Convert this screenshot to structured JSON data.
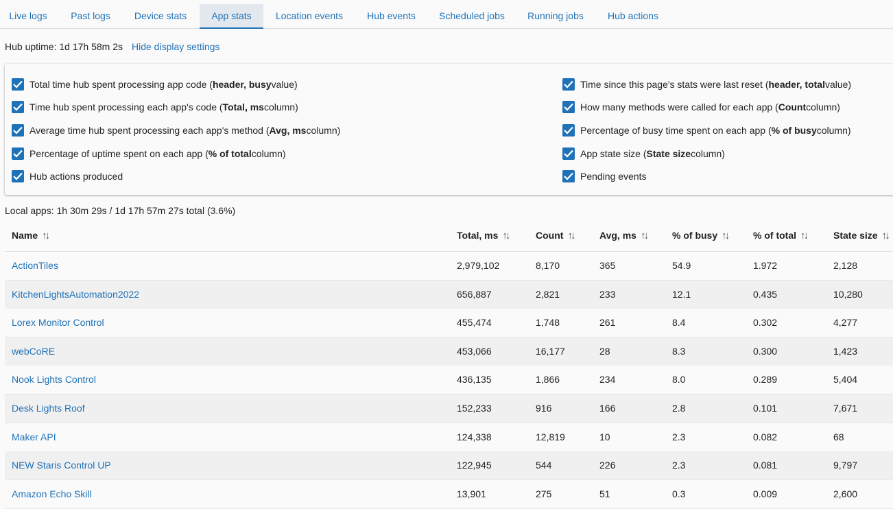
{
  "tabs": [
    {
      "label": "Live logs",
      "active": false
    },
    {
      "label": "Past logs",
      "active": false
    },
    {
      "label": "Device stats",
      "active": false
    },
    {
      "label": "App stats",
      "active": true
    },
    {
      "label": "Location events",
      "active": false
    },
    {
      "label": "Hub events",
      "active": false
    },
    {
      "label": "Scheduled jobs",
      "active": false
    },
    {
      "label": "Running jobs",
      "active": false
    },
    {
      "label": "Hub actions",
      "active": false
    }
  ],
  "uptime": {
    "text": "Hub uptime: 1d 17h 58m 2s",
    "toggle_label": "Hide display settings"
  },
  "settings": {
    "left": [
      {
        "pre": "Total time hub spent processing app code (",
        "bold": "header, busy",
        "post": " value)",
        "checked": true
      },
      {
        "pre": "Time hub spent processing each app's code (",
        "bold": "Total, ms",
        "post": " column)",
        "checked": true
      },
      {
        "pre": "Average time hub spent processing each app's method (",
        "bold": "Avg, ms",
        "post": " column)",
        "checked": true
      },
      {
        "pre": "Percentage of uptime spent on each app (",
        "bold": "% of total",
        "post": " column)",
        "checked": true
      },
      {
        "pre": "Hub actions produced",
        "bold": "",
        "post": "",
        "checked": true
      }
    ],
    "right": [
      {
        "pre": "Time since this page's stats were last reset (",
        "bold": "header, total",
        "post": " value)",
        "checked": true
      },
      {
        "pre": "How many methods were called for each app (",
        "bold": "Count",
        "post": " column)",
        "checked": true
      },
      {
        "pre": "Percentage of busy time spent on each app (",
        "bold": "% of busy",
        "post": " column)",
        "checked": true
      },
      {
        "pre": "App state size (",
        "bold": "State size",
        "post": " column)",
        "checked": true
      },
      {
        "pre": "Pending events",
        "bold": "",
        "post": "",
        "checked": true
      }
    ]
  },
  "summary": "Local apps: 1h 30m 29s / 1d 17h 57m 27s total (3.6%)",
  "table": {
    "columns": [
      "Name",
      "Total, ms",
      "Count",
      "Avg, ms",
      "% of busy",
      "% of total",
      "State size"
    ],
    "sort_glyph": "↑↓",
    "rows": [
      [
        "ActionTiles",
        "2,979,102",
        "8,170",
        "365",
        "54.9",
        "1.972",
        "2,128"
      ],
      [
        "KitchenLightsAutomation2022",
        "656,887",
        "2,821",
        "233",
        "12.1",
        "0.435",
        "10,280"
      ],
      [
        "Lorex Monitor Control",
        "455,474",
        "1,748",
        "261",
        "8.4",
        "0.302",
        "4,277"
      ],
      [
        "webCoRE",
        "453,066",
        "16,177",
        "28",
        "8.3",
        "0.300",
        "1,423"
      ],
      [
        "Nook Lights Control",
        "436,135",
        "1,866",
        "234",
        "8.0",
        "0.289",
        "5,404"
      ],
      [
        "Desk Lights Roof",
        "152,233",
        "916",
        "166",
        "2.8",
        "0.101",
        "7,671"
      ],
      [
        "Maker API",
        "124,338",
        "12,819",
        "10",
        "2.3",
        "0.082",
        "68"
      ],
      [
        "NEW Staris Control UP",
        "122,945",
        "544",
        "226",
        "2.3",
        "0.081",
        "9,797"
      ],
      [
        "Amazon Echo Skill",
        "13,901",
        "275",
        "51",
        "0.3",
        "0.009",
        "2,600"
      ]
    ]
  },
  "colors": {
    "accent": "#1f72b8",
    "active_tab_bg": "#e3e8ee"
  }
}
